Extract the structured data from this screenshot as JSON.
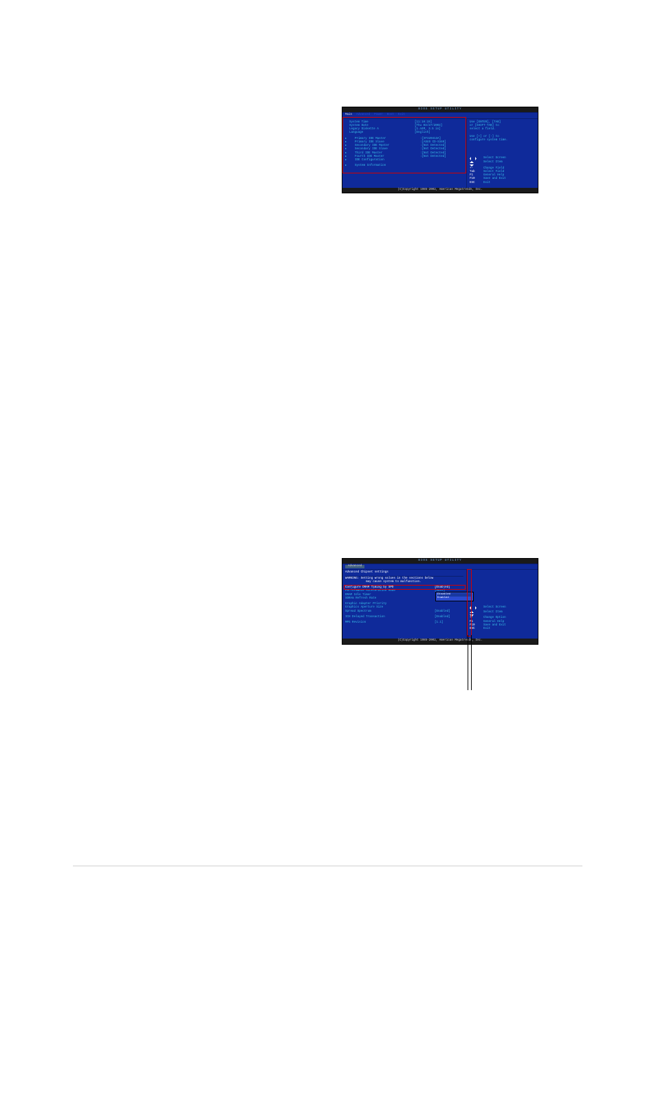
{
  "bios1": {
    "title": "BIOS SETUP UTILITY",
    "menu": [
      "Main",
      "Advanced",
      "Power",
      "Boot",
      "Exit"
    ],
    "active_menu_index": 0,
    "rows": [
      {
        "label": "System Time",
        "value": "[11:10:19]",
        "sub": false,
        "arrow": false
      },
      {
        "label": "System Date",
        "value": "[Thu 03/27/2003]",
        "sub": false,
        "arrow": false
      },
      {
        "label": "Legacy Diskette A",
        "value": "[1.44M, 3.5 in]",
        "sub": false,
        "arrow": false
      },
      {
        "label": "Language",
        "value": "[English]",
        "sub": false,
        "arrow": false
      },
      {
        "spacer": true
      },
      {
        "label": "Primary IDE Master",
        "value": ":[ST320413A]",
        "sub": true,
        "arrow": true
      },
      {
        "label": "Primary IDE Slave",
        "value": ":[ASUS CD-S340]",
        "sub": true,
        "arrow": true
      },
      {
        "label": "Secondary IDE Master",
        "value": ":[Not Detected]",
        "sub": true,
        "arrow": true
      },
      {
        "label": "Secondary IDE Slave",
        "value": ":[Not Detected]",
        "sub": true,
        "arrow": true
      },
      {
        "label": "Third IDE Master",
        "value": ":[Not Detected]",
        "sub": true,
        "arrow": true
      },
      {
        "label": "Fourth IDE Master",
        "value": ":[Not Detected]",
        "sub": true,
        "arrow": true
      },
      {
        "label": "IDE Configuration",
        "value": "",
        "sub": true,
        "arrow": true
      },
      {
        "spacer": true
      },
      {
        "label": "System Information",
        "value": "",
        "sub": true,
        "arrow": true
      }
    ],
    "help": [
      "Use [ENTER], [TAB]",
      "or [SHIFT-TAB] to",
      "select a field.",
      "",
      "Use [+] or [-] to",
      "configure system time."
    ],
    "legend": [
      {
        "key": "←→",
        "text": "Select Screen",
        "icon": "lr"
      },
      {
        "key": "↑↓",
        "text": "Select Item",
        "icon": "ud"
      },
      {
        "key": "+-",
        "text": "Change Field"
      },
      {
        "key": "Tab",
        "text": "Select Field"
      },
      {
        "key": "F1",
        "text": "General Help"
      },
      {
        "key": "F10",
        "text": "Save and Exit"
      },
      {
        "key": "ESC",
        "text": "Exit"
      }
    ],
    "copyright": "(C)Copyright 1985-2002, American Megatrends, Inc."
  },
  "bios2": {
    "title": "BIOS SETUP UTILITY",
    "menu": [
      "Advanced"
    ],
    "heading": "Advanced Chipset settings",
    "warning": "WARNING: Setting wrong values in the sections below\n            may cause system to malfunction.",
    "rows": [
      {
        "label": "Configure DRAM Timing by SPD",
        "value": "[Enabled]",
        "hl": true
      },
      {
        "label": "Performance Acceleration Mode",
        "value": "[Auto]"
      },
      {
        "label": "DRAM Idle Timer",
        "value": ""
      },
      {
        "label": "SDRAm Refresh Rate",
        "value": ""
      },
      {
        "spacer": true
      },
      {
        "label": "Graphic Adapter Priority",
        "value": ""
      },
      {
        "label": "Graphics Aperture Size",
        "value": ""
      },
      {
        "label": "Spread Spectrum",
        "value": "[Enabled]"
      },
      {
        "spacer": true
      },
      {
        "label": "ICH Delayed Transaction",
        "value": "[Enabled]"
      },
      {
        "spacer": true
      },
      {
        "label": "MPS Revision",
        "value": "[1.1]"
      }
    ],
    "popup": [
      "Disabled",
      "Enabled"
    ],
    "legend": [
      {
        "key": "←→",
        "text": "Select Screen",
        "icon": "lr"
      },
      {
        "key": "↑↓",
        "text": "Select Item",
        "icon": "ud"
      },
      {
        "key": "+-",
        "text": "Change Option"
      },
      {
        "key": "F1",
        "text": "General Help"
      },
      {
        "key": "F10",
        "text": "Save and Exit"
      },
      {
        "key": "ESC",
        "text": "Exit"
      }
    ],
    "copyright": "(C)Copyright 1985-2002, American Megatrends, Inc."
  }
}
